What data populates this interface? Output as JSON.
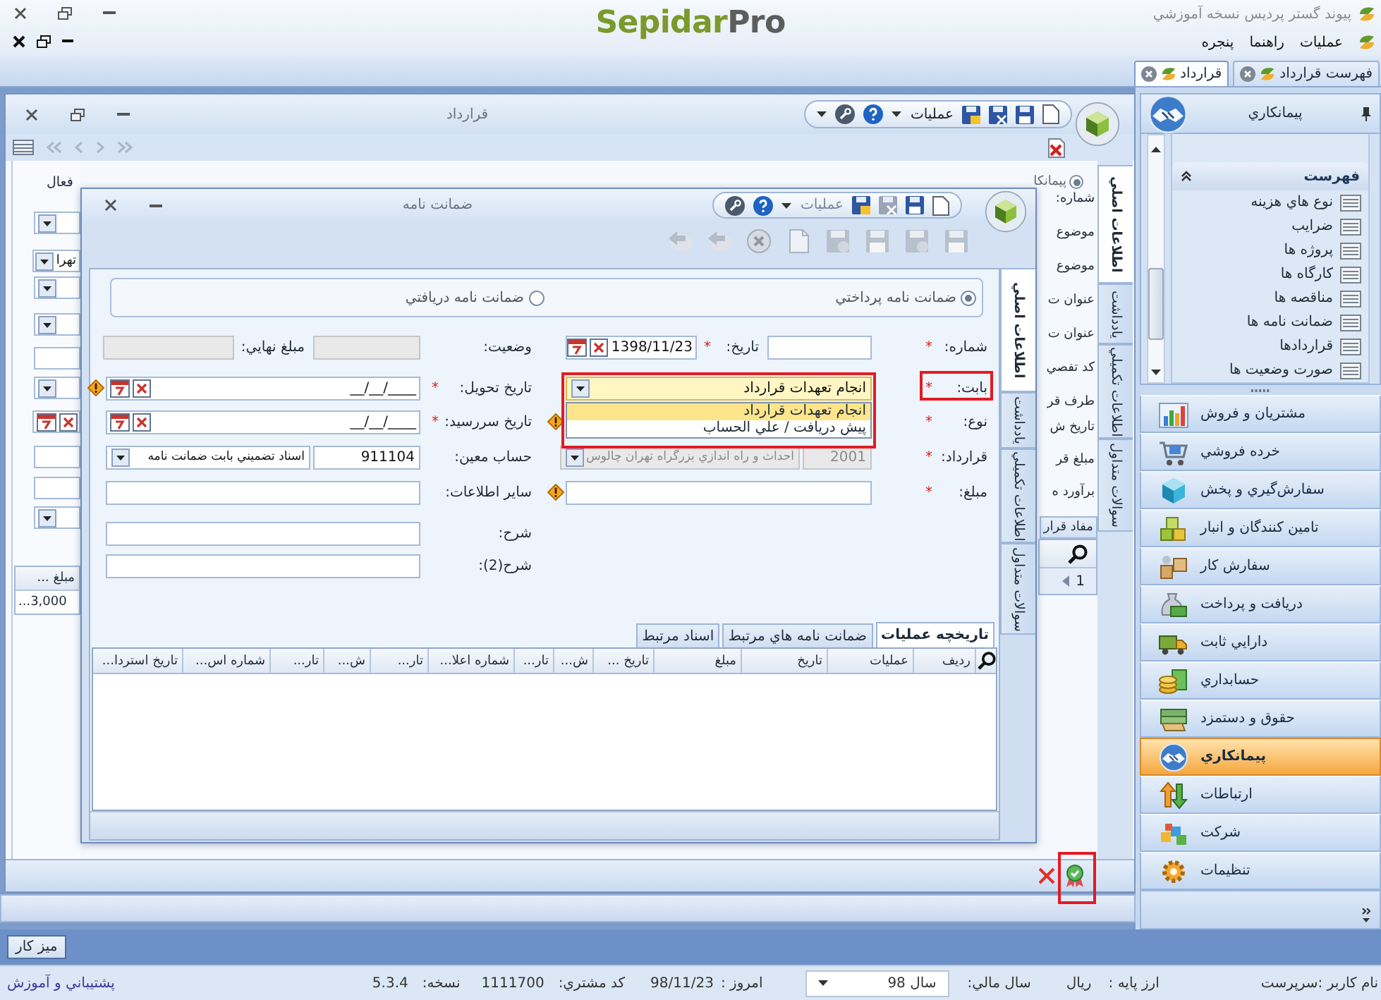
{
  "app": {
    "title": "پيوند گستر پرديس نسخه آموزشي",
    "logo": {
      "name": "Sepidar",
      "suffix": "Pro"
    }
  },
  "menu": [
    "عمليات",
    "راهنما",
    "پنجره"
  ],
  "doc_tabs": [
    {
      "label": "فهرست قرارداد",
      "selected": false
    },
    {
      "label": "قرارداد",
      "selected": true
    }
  ],
  "sidebar": {
    "title": "پيمانکاري",
    "section": {
      "title": "فهرست",
      "expanded": true,
      "items": [
        "نوع هاي هزينه",
        "ضرايب",
        "پروژه ها",
        "کارگاه ها",
        "مناقصه ها",
        "ضمانت نامه ها",
        "قراردادها",
        "صورت وضعيت ها"
      ]
    },
    "modules": [
      {
        "label": "مشتريان و فروش",
        "selected": false
      },
      {
        "label": "خرده فروشي",
        "selected": false
      },
      {
        "label": "سفارش‌گيري و پخش",
        "selected": false
      },
      {
        "label": "تامين کنندگان و انبار",
        "selected": false
      },
      {
        "label": "سفارش کار",
        "selected": false
      },
      {
        "label": "دريافت و پرداخت",
        "selected": false
      },
      {
        "label": "دارايي ثابت",
        "selected": false
      },
      {
        "label": "حسابداري",
        "selected": false
      },
      {
        "label": "حقوق و دستمزد",
        "selected": false
      },
      {
        "label": "پيمانکاري",
        "selected": true
      },
      {
        "label": "ارتباطات",
        "selected": false
      },
      {
        "label": "شرکت",
        "selected": false
      },
      {
        "label": "تنظيمات",
        "selected": false
      }
    ]
  },
  "contract_window": {
    "title": "قرارداد",
    "toolbar_menu": "عمليات",
    "active_label": "فعال",
    "contractor_option": {
      "label": "پيمانکا",
      "selected": true
    },
    "left_fields": [
      {
        "kind": "dropdown"
      },
      {
        "kind": "dropdown",
        "value": "تهرا"
      },
      {
        "kind": "dropdown"
      },
      {
        "kind": "dropdown"
      },
      {
        "kind": "text"
      },
      {
        "kind": "dropdown"
      },
      {
        "kind": "date"
      },
      {
        "kind": "text"
      },
      {
        "kind": "text"
      },
      {
        "kind": "dropdown"
      }
    ],
    "labels": [
      "شماره:",
      "موضوع",
      "موضوع",
      "عنوان ت",
      "عنوان ت",
      "کد تفصي",
      "طرف قر",
      "تاريخ ش",
      "مبلغ قر",
      "برآورد ه"
    ],
    "amount_table": {
      "column": "مبلغ ...",
      "cell": "...3,000"
    },
    "inner_tab": "مفاد قرار",
    "pager": "1",
    "side_tabs": [
      {
        "label": "اطلاعات اصلي",
        "selected": true
      },
      {
        "label": "يادداشت",
        "selected": false
      },
      {
        "label": "اطلاعات تکميلي",
        "selected": false
      },
      {
        "label": "سوالات متداول",
        "selected": false
      }
    ],
    "confirm": {
      "highlighted": true
    }
  },
  "guarantee_dialog": {
    "title": "ضمانت نامه",
    "toolbar_menu": "عمليات",
    "side_tabs": [
      {
        "label": "اطلاعات اصلي",
        "selected": true
      },
      {
        "label": "يادداشت",
        "selected": false
      },
      {
        "label": "اطلاعات تکميلي",
        "selected": false
      },
      {
        "label": "سوالات متداول",
        "selected": false
      }
    ],
    "direction_options": [
      {
        "label": "ضمانت نامه پرداختي",
        "selected": true
      },
      {
        "label": "ضمانت نامه دريافتي",
        "selected": false
      }
    ],
    "rows": [
      {
        "right": {
          "label": "شماره:",
          "required_mark": "*",
          "kind": "split",
          "sub": {
            "label": "تاريخ:",
            "required_mark": "*",
            "kind": "date",
            "value": "1398/11/23"
          }
        },
        "left": {
          "label": "وضعيت:",
          "kind": "split",
          "disabled": true,
          "sub": {
            "label": "مبلغ نهايي:",
            "kind": "text",
            "disabled": true
          }
        }
      },
      {
        "right": {
          "label": "بابت:",
          "required_mark": "*",
          "kind": "dropdown",
          "value": "انجام تعهدات قرارداد",
          "focused": true,
          "highlighted": true,
          "open": true,
          "options": [
            {
              "label": "انجام تعهدات قرارداد",
              "selected": true
            },
            {
              "label": "پيش دريافت / علي الحساب",
              "selected": false
            }
          ]
        },
        "left": {
          "label": "تاريخ تحويل:",
          "required_mark": "*",
          "kind": "date",
          "value": "__/__/____",
          "warning": true
        }
      },
      {
        "right": {
          "label": "نوع:",
          "required_mark": "*",
          "warning": true
        },
        "left": {
          "label": "تاريخ سررسيد:",
          "required_mark": "*",
          "kind": "date",
          "value": "__/__/____"
        }
      },
      {
        "right": {
          "label": "قرارداد:",
          "required_mark": "*",
          "kind": "lookup",
          "code": "2001",
          "value": "احداث و راه اندازي بزرگراه تهران چالوس",
          "disabled": true
        },
        "left": {
          "label": "حساب معين:",
          "kind": "lookup",
          "code": "911104",
          "value": "اسناد تضميني بابت ضمانت نامه"
        }
      },
      {
        "right": {
          "label": "مبلغ:",
          "required_mark": "*",
          "kind": "text",
          "warning": true
        },
        "left": {
          "label": "ساير اطلاعات:",
          "kind": "text"
        }
      },
      {
        "left": {
          "label": "شرح:",
          "kind": "text"
        }
      },
      {
        "left": {
          "label": "شرح(2):",
          "kind": "text"
        }
      }
    ],
    "tabs": [
      {
        "label": "تاريخچه عمليات",
        "selected": true
      },
      {
        "label": "ضمانت نامه هاي مرتبط",
        "selected": false
      },
      {
        "label": "اسناد مرتبط",
        "selected": false
      }
    ],
    "history_table": {
      "columns": [
        "رديف",
        "عمليات",
        "تاريخ",
        "مبلغ",
        "تاريخ ...",
        "ش...",
        "تار...",
        "شماره اعلا...",
        "تار...",
        "ش...",
        "تار...",
        "شماره اس...",
        "تاريخ استردا..."
      ]
    }
  },
  "taskbar": {
    "button": "ميز کار"
  },
  "status_bar": {
    "user": "نام کاربر :سرپرست",
    "currency_label": "ارز پايه :",
    "currency": "ريال",
    "fiscal_year_label": "سال مالي:",
    "fiscal_year": "سال 98",
    "today_label": "امروز :",
    "today": "98/11/23",
    "customer_code_label": "کد مشتري:",
    "customer_code": "1111700",
    "version_label": "نسخه:",
    "version": "5.3.4",
    "support_link": "پشتيباني و آموزش"
  }
}
